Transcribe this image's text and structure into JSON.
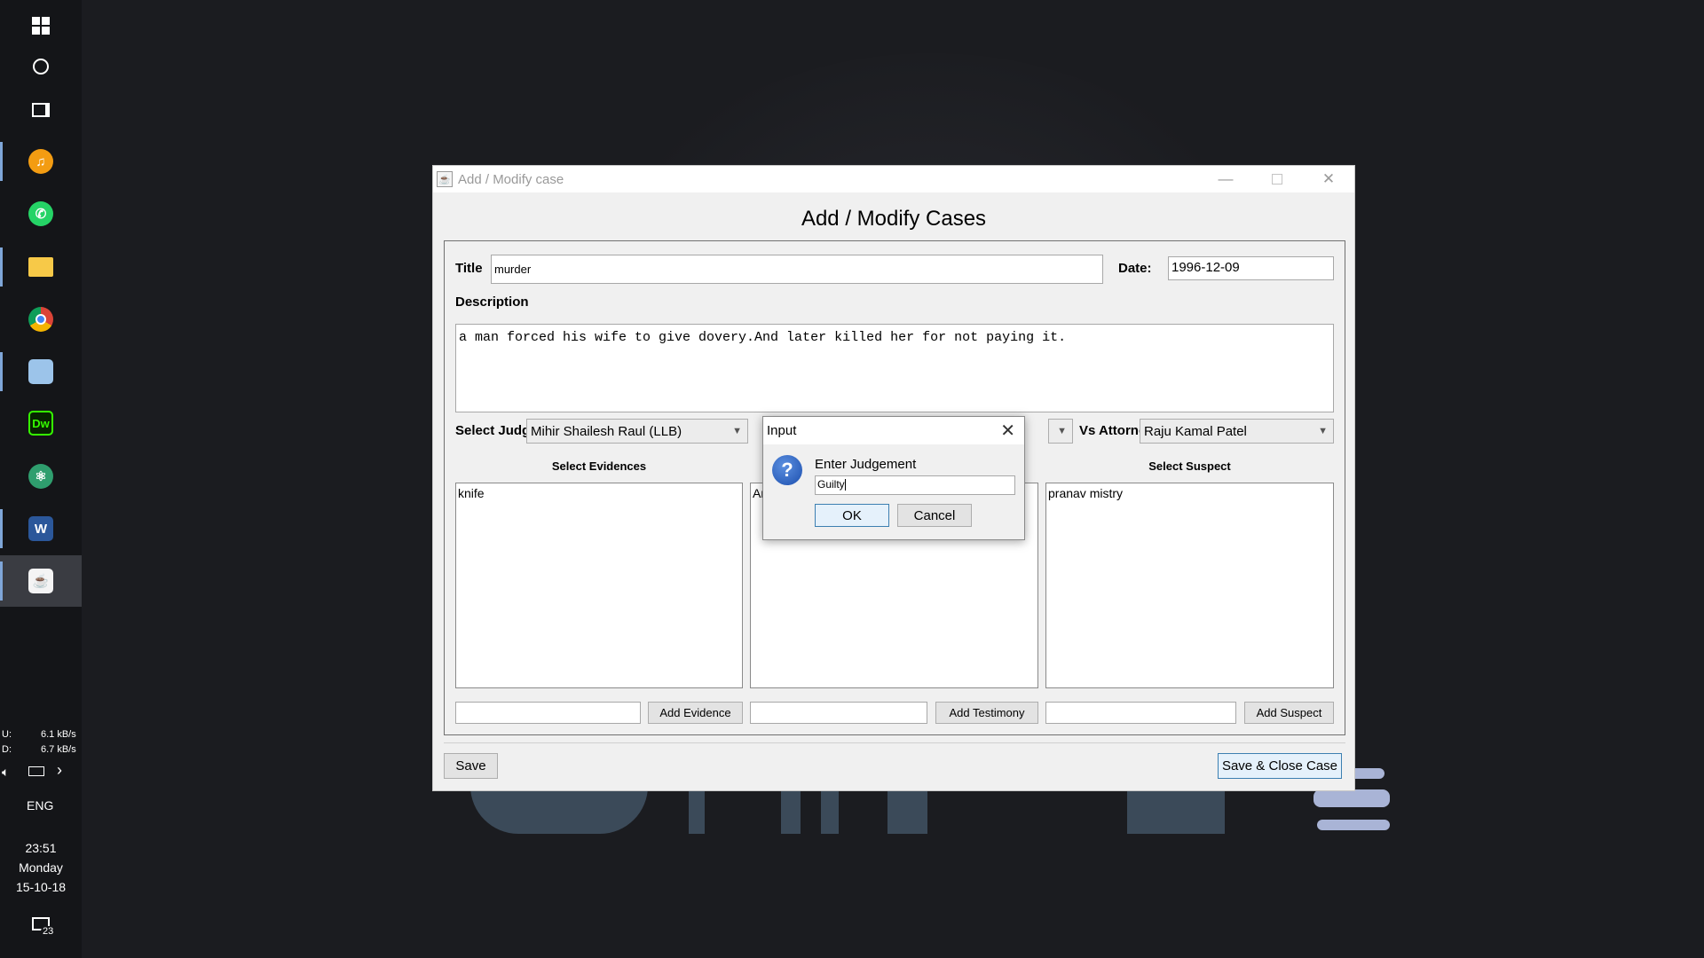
{
  "taskbar": {
    "icons": [
      "windows-start-icon",
      "cortana-search-icon",
      "task-view-icon",
      "music-app-icon",
      "whatsapp-icon",
      "file-explorer-icon",
      "chrome-icon",
      "cube-app-icon",
      "dreamweaver-icon",
      "atom-icon",
      "word-icon",
      "java-app-icon"
    ],
    "dreamweaver_label": "Dw",
    "word_label": "W",
    "net_upload_label": "U:",
    "net_upload": "6.1 kB/s",
    "net_download_label": "D:",
    "net_download": "6.7 kB/s",
    "language": "ENG",
    "time": "23:51",
    "day": "Monday",
    "date": "15-10-18",
    "notification_count": "23"
  },
  "window": {
    "title": "Add / Modify case",
    "heading": "Add / Modify Cases",
    "title_label": "Title",
    "title_value": "murder",
    "date_label": "Date:",
    "date_value": "1996-12-09",
    "description_label": "Description",
    "description_value": "a man forced his wife to give dovery.And later killed her for not paying it.",
    "judge_label": "Select Judge",
    "judge_value": "Mihir Shailesh Raul (LLB)",
    "attorney_label": "Vs Attorney",
    "attorney_value": "Raju Kamal Patel",
    "evidences_header": "Select Evidences",
    "evidences": [
      "knife"
    ],
    "testimony_partial": "Ar",
    "suspect_header": "Select Suspect",
    "suspects": [
      "pranav mistry"
    ],
    "add_evidence": "Add Evidence",
    "add_testimony": "Add Testimony",
    "add_suspect": "Add Suspect",
    "save": "Save",
    "save_close": "Save & Close Case"
  },
  "dialog": {
    "title": "Input",
    "prompt": "Enter Judgement",
    "input_value": "Guilty",
    "ok": "OK",
    "cancel": "Cancel"
  },
  "colors": {
    "desktop": "#1b1c20",
    "taskbar": "#141518",
    "window_bg": "#f0f0f0",
    "accent": "#3c7fb1"
  }
}
